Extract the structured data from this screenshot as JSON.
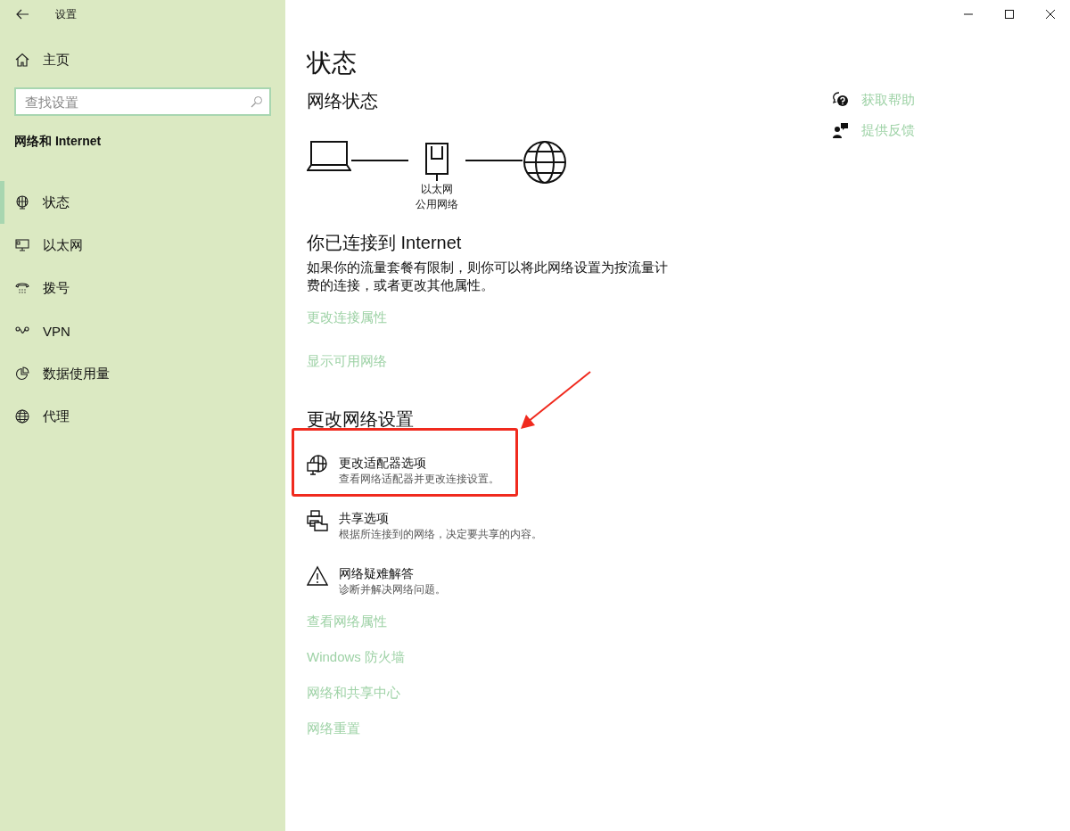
{
  "window": {
    "title": "设置"
  },
  "sidebar": {
    "home": "主页",
    "search": {
      "placeholder": "查找设置"
    },
    "section": "网络和 Internet",
    "items": [
      {
        "label": "状态",
        "kind": "status",
        "selected": true
      },
      {
        "label": "以太网",
        "kind": "ethernet",
        "selected": false
      },
      {
        "label": "拨号",
        "kind": "dialup",
        "selected": false
      },
      {
        "label": "VPN",
        "kind": "vpn",
        "selected": false
      },
      {
        "label": "数据使用量",
        "kind": "data",
        "selected": false
      },
      {
        "label": "代理",
        "kind": "proxy",
        "selected": false
      }
    ]
  },
  "main": {
    "title": "状态",
    "network_status": {
      "heading": "网络状态",
      "adapter": "以太网",
      "network_type": "公用网络"
    },
    "connected": {
      "heading": "你已连接到 Internet",
      "description": "如果你的流量套餐有限制，则你可以将此网络设置为按流量计费的连接，或者更改其他属性。"
    },
    "links": [
      "更改连接属性",
      "显示可用网络"
    ],
    "change_settings": {
      "heading": "更改网络设置",
      "options": [
        {
          "kind": "adapter",
          "title": "更改适配器选项",
          "description": "查看网络适配器并更改连接设置。",
          "highlighted": true
        },
        {
          "kind": "sharing",
          "title": "共享选项",
          "description": "根据所连接到的网络，决定要共享的内容。",
          "highlighted": false
        },
        {
          "kind": "troubleshoot",
          "title": "网络疑难解答",
          "description": "诊断并解决网络问题。",
          "highlighted": false
        }
      ]
    },
    "more_links": [
      "查看网络属性",
      "Windows 防火墙",
      "网络和共享中心",
      "网络重置"
    ]
  },
  "help_links": [
    {
      "kind": "help",
      "label": "获取帮助"
    },
    {
      "kind": "feedback",
      "label": "提供反馈"
    }
  ]
}
